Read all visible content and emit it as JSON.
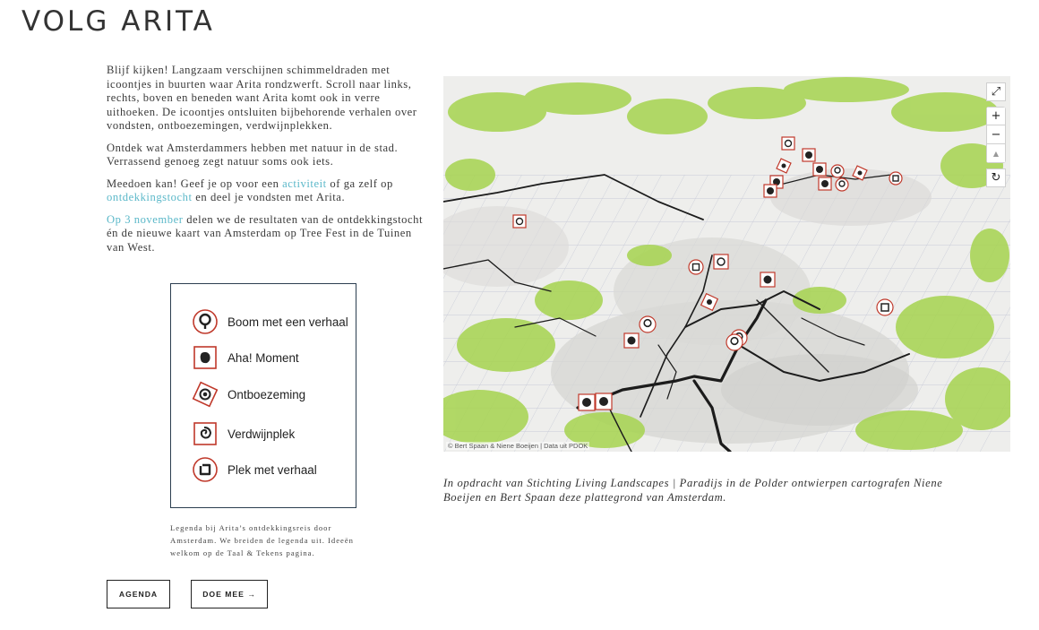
{
  "page": {
    "title": "VOLG ARITA"
  },
  "intro": {
    "p1": "Blijf kijken! Langzaam verschijnen schimmeldraden met icoontjes in buurten waar Arita rondzwerft. Scroll naar links, rechts, boven en beneden want Arita komt ook in verre uithoeken. De icoontjes ontsluiten bijbehorende verhalen over vondsten, ontboezemingen, verdwijnplekken.",
    "p2": "Ontdek wat Amsterdammers hebben met natuur in de stad. Verrassend genoeg zegt natuur soms ook iets.",
    "p3_before": "Meedoen kan! Geef je op voor een ",
    "p3_link1": "activiteit",
    "p3_middle": " of ga zelf op ",
    "p3_link2": "ontdekkingstocht",
    "p3_after": " en deel je vondsten met Arita.",
    "p4_link": "Op 3 november",
    "p4_after": " delen we de resultaten van de ontdekkingstocht én de nieuwe kaart van Amsterdam op Tree Fest in de Tuinen van West."
  },
  "legend": {
    "items": [
      {
        "icon": "tree-story-icon",
        "label": "Boom met een verhaal"
      },
      {
        "icon": "aha-moment-icon",
        "label": "Aha! Moment"
      },
      {
        "icon": "outpouring-icon",
        "label": "Ontboezeming"
      },
      {
        "icon": "vanishing-spot-icon",
        "label": "Verdwijnplek"
      },
      {
        "icon": "place-story-icon",
        "label": "Plek met verhaal"
      }
    ],
    "caption": "Legenda bij Arita’s ontdekkingsreis door Amsterdam. We breiden de legenda uit. Ideeën welkom op de Taal & Tekens pagina."
  },
  "buttons": {
    "agenda": "AGENDA",
    "doe_mee": "DOE MEE →"
  },
  "map": {
    "attribution": "© Bert Spaan & Niene Boeijen | Data uit PDOK",
    "controls": {
      "fullscreen": "⤢",
      "zoom_in": "+",
      "zoom_out": "−",
      "compass": "▲",
      "reset": "↻"
    },
    "caption": "In opdracht van Stichting Living Landscapes | Paradijs in de Polder ontwierpen cartografen Niene Boeijen en Bert Spaan deze plattegrond van Amsterdam."
  },
  "colors": {
    "accent_link": "#5bb8c9",
    "marker_red": "#c0392b",
    "green_canopy": "#a6d44f",
    "frame": "#2c3e50"
  }
}
